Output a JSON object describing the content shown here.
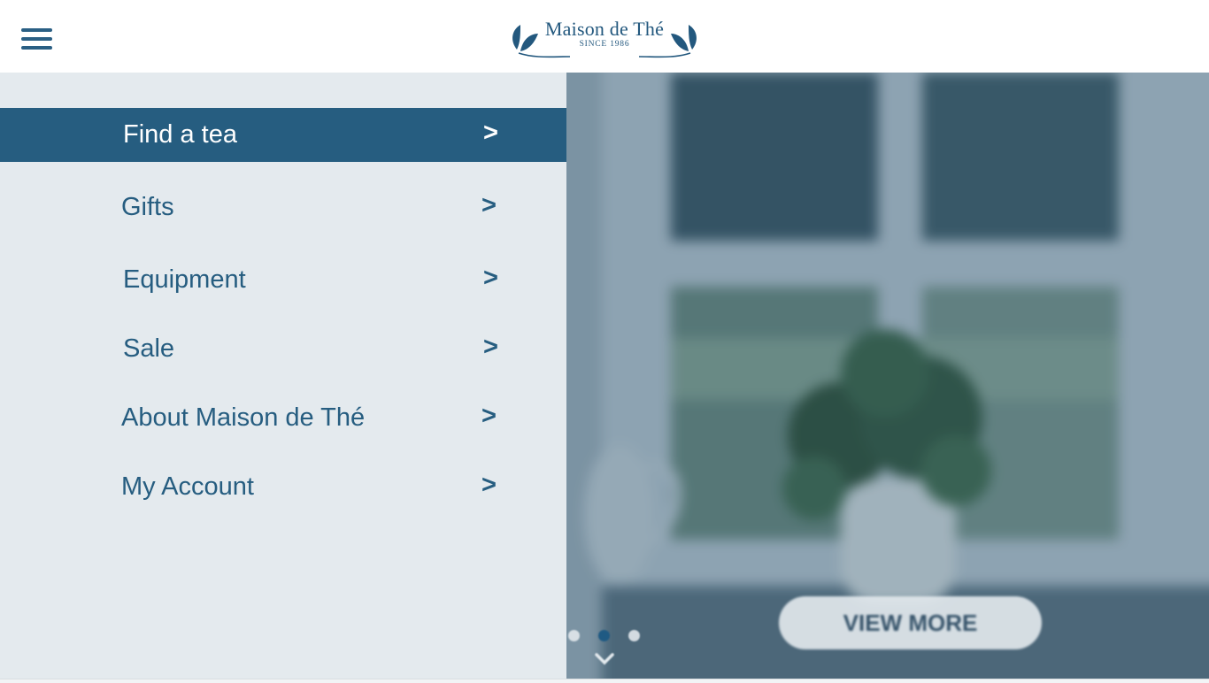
{
  "header": {
    "menu_icon": "hamburger-menu-icon",
    "logo": {
      "name": "Maison de Thé",
      "tagline": "SINCE 1986",
      "icon": "tea-leaf-icon"
    }
  },
  "side_menu": {
    "items": [
      {
        "label": "Find a tea",
        "arrow": ">",
        "active": true
      },
      {
        "label": "Gifts",
        "arrow": ">",
        "active": false
      },
      {
        "label": "Equipment",
        "arrow": ">",
        "active": false
      },
      {
        "label": "Sale",
        "arrow": ">",
        "active": false
      },
      {
        "label": "About Maison de Thé",
        "arrow": ">",
        "active": false
      },
      {
        "label": "My Account",
        "arrow": ">",
        "active": false
      }
    ]
  },
  "hero": {
    "cta_label": "VIEW MORE",
    "carousel": {
      "slide_count": 3,
      "current_slide": 2
    },
    "scroll_icon": "chevron-down-icon"
  },
  "colors": {
    "brand": "#265d80",
    "menu_active_background": "#265d80",
    "menu_panel_background": "#f6f8fa",
    "header_background": "#ffffff"
  }
}
